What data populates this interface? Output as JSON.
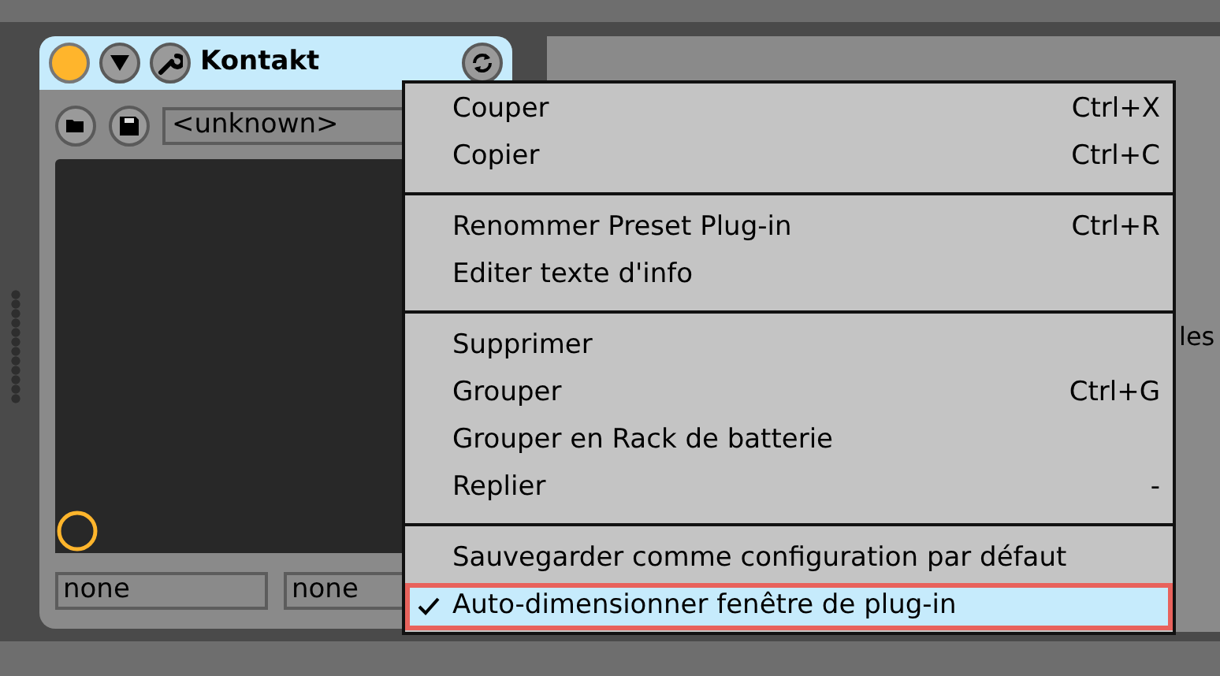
{
  "device": {
    "title": "Kontakt",
    "active": true,
    "preset": "<unknown>",
    "fields": [
      "none",
      "none"
    ]
  },
  "right_panel": {
    "text": "les"
  },
  "context_menu": {
    "groups": [
      {
        "items": [
          {
            "label": "Couper",
            "shortcut": "Ctrl+X",
            "checked": false,
            "selected": false
          },
          {
            "label": "Copier",
            "shortcut": "Ctrl+C",
            "checked": false,
            "selected": false
          }
        ]
      },
      {
        "items": [
          {
            "label": "Renommer Preset Plug-in",
            "shortcut": "Ctrl+R",
            "checked": false,
            "selected": false
          },
          {
            "label": "Editer texte d'info",
            "checked": false,
            "selected": false
          }
        ]
      },
      {
        "items": [
          {
            "label": "Supprimer",
            "checked": false,
            "selected": false
          },
          {
            "label": "Grouper",
            "shortcut": "Ctrl+G",
            "checked": false,
            "selected": false
          },
          {
            "label": "Grouper en Rack de batterie",
            "checked": false,
            "selected": false
          },
          {
            "label": "Replier",
            "shortcut": "-",
            "checked": false,
            "selected": false
          }
        ]
      },
      {
        "items": [
          {
            "label": "Sauvegarder comme configuration par défaut",
            "checked": false,
            "selected": false
          },
          {
            "label": "Auto-dimensionner fenêtre de plug-in",
            "checked": true,
            "selected": true
          }
        ]
      }
    ]
  }
}
